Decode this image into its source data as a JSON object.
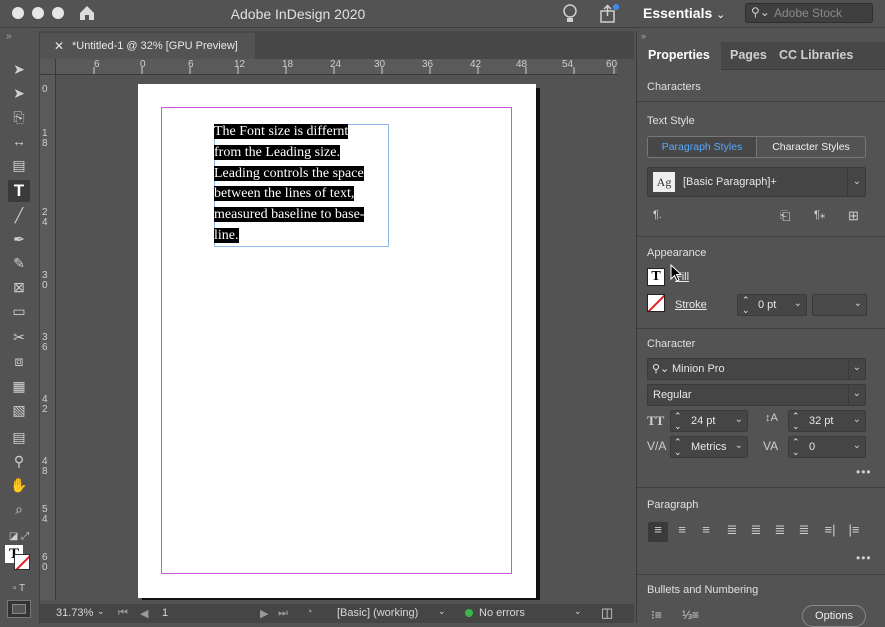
{
  "window": {
    "title": "Adobe InDesign 2020",
    "workspace": "Essentials"
  },
  "search": {
    "placeholder": "Adobe Stock"
  },
  "document": {
    "tab_title": "*Untitled-1 @ 32% [GPU Preview]"
  },
  "rulers": {
    "horizontal": [
      "6",
      "0",
      "6",
      "12",
      "18",
      "24",
      "30",
      "36",
      "42",
      "48",
      "54",
      "60"
    ],
    "vertical": [
      "0",
      "1 8",
      "2 4",
      "3 0",
      "3 6",
      "4 2",
      "4 8",
      "5 4",
      "6 0"
    ]
  },
  "text_frame": {
    "lines": [
      "The Font size is differnt",
      "from the Leading size.",
      "Leading controls the space",
      "between the lines of text,",
      "measured baseline to base-",
      "line."
    ]
  },
  "statusbar": {
    "zoom": "31.73%",
    "page": "1",
    "preflight_profile": "[Basic] (working)",
    "errors": "No errors"
  },
  "panel": {
    "tabs": [
      "Properties",
      "Pages",
      "CC Libraries"
    ],
    "characters_label": "Characters",
    "text_style": {
      "title": "Text Style",
      "paragraph_styles": "Paragraph Styles",
      "character_styles": "Character Styles",
      "style_icon": "Ag",
      "current": "[Basic Paragraph]+"
    },
    "appearance": {
      "title": "Appearance",
      "fill": "Fill",
      "stroke": "Stroke",
      "stroke_weight": "0 pt"
    },
    "character": {
      "title": "Character",
      "font": "Minion Pro",
      "style": "Regular",
      "size": "24 pt",
      "leading": "32 pt",
      "kerning": "Metrics",
      "tracking": "0"
    },
    "paragraph": {
      "title": "Paragraph"
    },
    "bullets": {
      "title": "Bullets and Numbering",
      "options": "Options"
    }
  },
  "colors": {
    "accent": "#58a8ff",
    "margin_guide": "#c858d8",
    "frame_edge": "#8fb8e8"
  }
}
